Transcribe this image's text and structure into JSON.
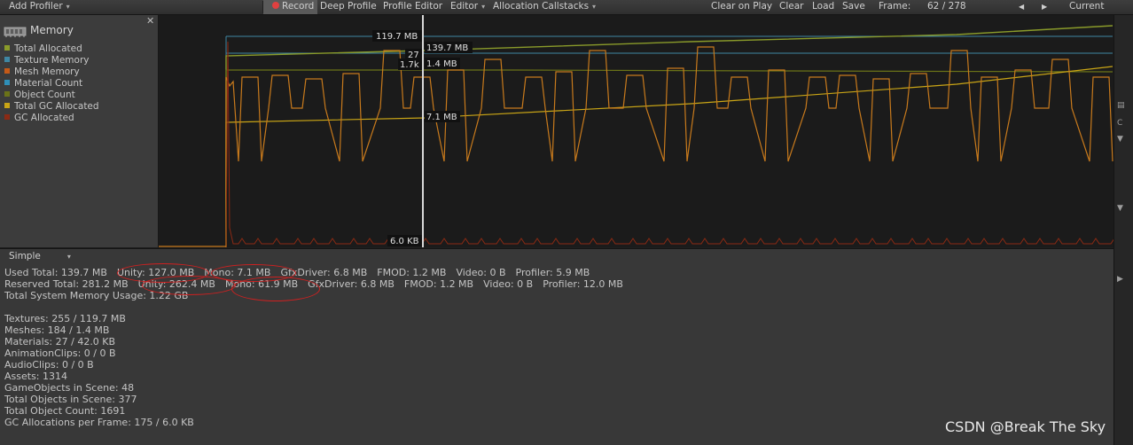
{
  "toolbar": {
    "add_profiler": "Add Profiler",
    "record": "Record",
    "deep_profile": "Deep Profile",
    "profile_editor": "Profile Editor",
    "editor": "Editor",
    "allocation_callstacks": "Allocation Callstacks",
    "clear_on_play": "Clear on Play",
    "clear": "Clear",
    "load": "Load",
    "save": "Save",
    "frame_label": "Frame:",
    "frame_value": "62 / 278",
    "current": "Current"
  },
  "legend": {
    "title": "Memory",
    "items": [
      {
        "label": "Total Allocated",
        "color": "#8a9b2a"
      },
      {
        "label": "Texture Memory",
        "color": "#3f87a3"
      },
      {
        "label": "Mesh Memory",
        "color": "#c55a18"
      },
      {
        "label": "Material Count",
        "color": "#2f8fb8"
      },
      {
        "label": "Object Count",
        "color": "#6b7318"
      },
      {
        "label": "Total GC Allocated",
        "color": "#c9a516"
      },
      {
        "label": "GC Allocated",
        "color": "#8c2a14"
      }
    ]
  },
  "chart_data": {
    "type": "line",
    "frame_selected": 62,
    "frame_total": 278,
    "annotations": [
      "119.7 MB",
      "139.7 MB",
      "27",
      "1.7k",
      "1.4 MB",
      "7.1 MB",
      "6.0 KB"
    ]
  },
  "detail": {
    "mode": "Simple",
    "used_total": [
      "Used Total: 139.7 MB",
      "Unity: 127.0 MB",
      "Mono: 7.1 MB",
      "GfxDriver: 6.8 MB",
      "FMOD: 1.2 MB",
      "Video: 0 B",
      "Profiler: 5.9 MB"
    ],
    "reserved_total": [
      "Reserved Total: 281.2 MB",
      "Unity: 262.4 MB",
      "Mono: 61.9 MB",
      "GfxDriver: 6.8 MB",
      "FMOD: 1.2 MB",
      "Video: 0 B",
      "Profiler: 12.0 MB"
    ],
    "system_memory": "Total System Memory Usage: 1.22 GB",
    "stats": [
      "Textures: 255 / 119.7 MB",
      "Meshes: 184 / 1.4 MB",
      "Materials: 27 / 42.0 KB",
      "AnimationClips: 0 / 0 B",
      "AudioClips: 0 / 0 B",
      "Assets: 1314",
      "GameObjects in Scene: 48",
      "Total Objects in Scene: 377",
      "Total Object Count: 1691",
      "GC Allocations per Frame: 175 / 6.0 KB"
    ]
  },
  "watermark": "CSDN @Break The Sky"
}
